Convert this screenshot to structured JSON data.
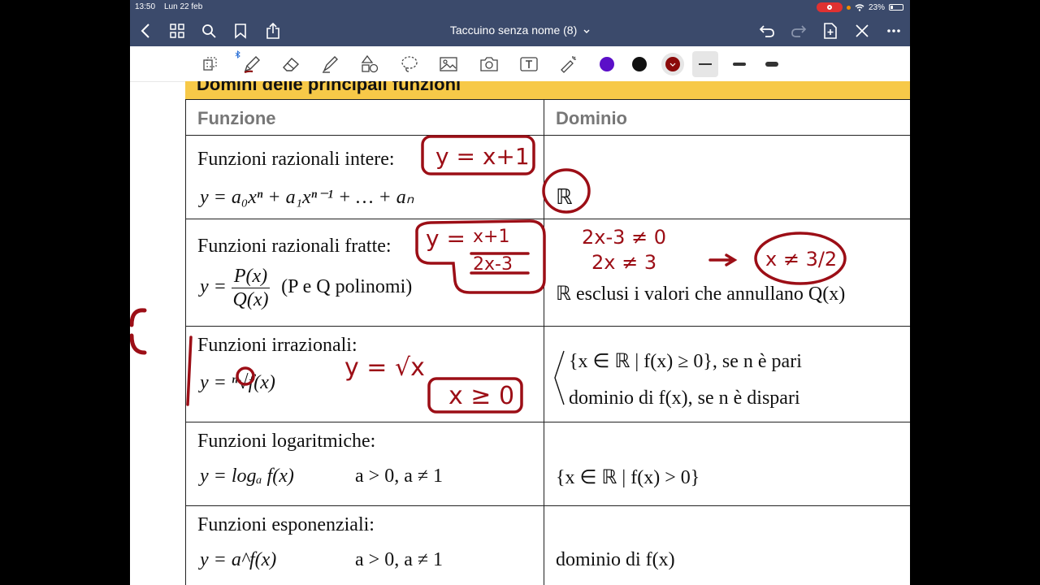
{
  "status_bar": {
    "time": "13:50",
    "date": "Lun 22 feb",
    "battery": "23%",
    "battery_level": 0.23
  },
  "nav": {
    "title": "Taccuino senza nome (8)"
  },
  "toolbar": {
    "tools": [
      "lasso-icon",
      "pen-icon",
      "eraser-icon",
      "highlighter-icon",
      "shapes-icon",
      "lasso-select-icon",
      "image-icon",
      "camera-icon",
      "text-icon",
      "laser-pointer-icon"
    ],
    "colors": [
      "#5b0fc8",
      "#111111",
      "#8b0a0a"
    ],
    "selected_color": "#8b0a0a"
  },
  "table": {
    "banner": "Domini delle principali funzioni",
    "headers": {
      "funzione": "Funzione",
      "dominio": "Dominio"
    },
    "rows": {
      "r1": {
        "name": "Funzioni razionali intere:",
        "formula": "y = a₀xⁿ + a₁xⁿ⁻¹ + … + aₙ",
        "domain": "ℝ"
      },
      "r2": {
        "name": "Funzioni razionali fratte:",
        "numerator": "P(x)",
        "denominator": "Q(x)",
        "note": "(P e Q polinomi)",
        "domain": "ℝ esclusi i valori che annullano Q(x)"
      },
      "r3": {
        "name": "Funzioni irrazionali:",
        "formula": "y = ⁿ√f(x)",
        "domain_even": "{x ∈ ℝ | f(x) ≥ 0}, se n è pari",
        "domain_odd": "dominio di f(x), se n è dispari"
      },
      "r4": {
        "name": "Funzioni logaritmiche:",
        "formula": "y = logₐ f(x)",
        "condition": "a > 0, a ≠ 1",
        "domain": "{x ∈ ℝ | f(x) > 0}"
      },
      "r5": {
        "name": "Funzioni esponenziali:",
        "formula": "y = a^f(x)",
        "condition": "a > 0, a ≠ 1",
        "domain": "dominio di f(x)"
      }
    }
  },
  "annotations": {
    "a1": "y = x+1",
    "a2_num": "x+1",
    "a2_den": "2x-3",
    "a3_line1": "2x-3 ≠ 0",
    "a3_line2": "2x ≠ 3",
    "a4": "x ≠ 3/2",
    "a5": "y = √x",
    "a6": "x ≥ 0"
  }
}
